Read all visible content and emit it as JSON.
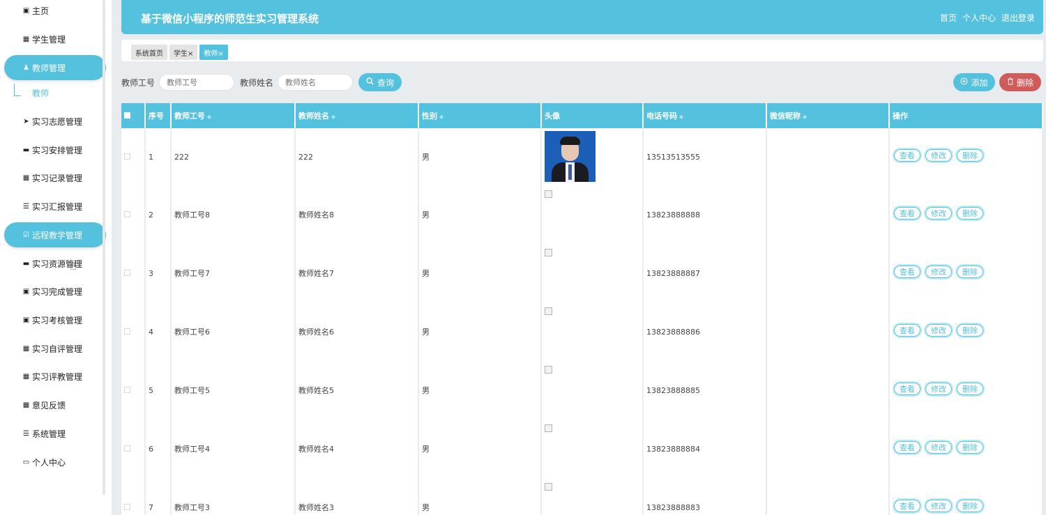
{
  "app_title": "基于微信小程序的师范生实习管理系统",
  "header_links": [
    "首页",
    "个人中心",
    "退出登录"
  ],
  "sidebar": {
    "items": [
      {
        "label": "主页",
        "icon": "home-icon",
        "glyph": "▣"
      },
      {
        "label": "学生管理",
        "icon": "grid-icon",
        "glyph": "▦"
      },
      {
        "label": "教师管理",
        "icon": "thumb-icon",
        "glyph": "♟"
      },
      {
        "label": "实习志愿管理",
        "icon": "send-icon",
        "glyph": "➤"
      },
      {
        "label": "实习安排管理",
        "icon": "monitor-icon",
        "glyph": "▬"
      },
      {
        "label": "实习记录管理",
        "icon": "grid-icon",
        "glyph": "▦"
      },
      {
        "label": "实习汇报管理",
        "icon": "list-icon",
        "glyph": "☰"
      },
      {
        "label": "远程教学管理",
        "icon": "check-square-icon",
        "glyph": "☑"
      },
      {
        "label": "实习资源管理",
        "icon": "monitor-icon",
        "glyph": "▬"
      },
      {
        "label": "实习完成管理",
        "icon": "clipboard-icon",
        "glyph": "▣"
      },
      {
        "label": "实习考核管理",
        "icon": "clipboard-icon",
        "glyph": "▣"
      },
      {
        "label": "实习自评管理",
        "icon": "grid-icon",
        "glyph": "▦"
      },
      {
        "label": "实习评教管理",
        "icon": "grid-icon",
        "glyph": "▦"
      },
      {
        "label": "意见反馈",
        "icon": "grid-icon",
        "glyph": "▦"
      },
      {
        "label": "系统管理",
        "icon": "list-icon",
        "glyph": "☰"
      },
      {
        "label": "个人中心",
        "icon": "card-icon",
        "glyph": "▭"
      }
    ],
    "submenu": "教师"
  },
  "tabs": [
    {
      "label": "系统首页",
      "active": false
    },
    {
      "label": "学生×",
      "active": false
    },
    {
      "label": "教师×",
      "active": true
    }
  ],
  "search": {
    "field1_label": "教师工号",
    "field1_placeholder": "教师工号",
    "field2_label": "教师姓名",
    "field2_placeholder": "教师姓名",
    "query_label": "查询",
    "query_icon": "search-icon"
  },
  "actions": {
    "add_label": "添加",
    "add_icon": "plus-circle-icon",
    "delete_label": "删除",
    "delete_icon": "trash-icon"
  },
  "table": {
    "columns": [
      "序号",
      "教师工号",
      "教师姓名",
      "性别",
      "头像",
      "电话号码",
      "微信昵称",
      "操作"
    ],
    "rows": [
      {
        "index": "1",
        "id": "222",
        "name": "222",
        "gender": "男",
        "phone": "13513513555",
        "wechat": "",
        "has_photo": true
      },
      {
        "index": "2",
        "id": "教师工号8",
        "name": "教师姓名8",
        "gender": "男",
        "phone": "13823888888",
        "wechat": "",
        "has_photo": false
      },
      {
        "index": "3",
        "id": "教师工号7",
        "name": "教师姓名7",
        "gender": "男",
        "phone": "13823888887",
        "wechat": "",
        "has_photo": false
      },
      {
        "index": "4",
        "id": "教师工号6",
        "name": "教师姓名6",
        "gender": "男",
        "phone": "13823888886",
        "wechat": "",
        "has_photo": false
      },
      {
        "index": "5",
        "id": "教师工号5",
        "name": "教师姓名5",
        "gender": "男",
        "phone": "13823888885",
        "wechat": "",
        "has_photo": false
      },
      {
        "index": "6",
        "id": "教师工号4",
        "name": "教师姓名4",
        "gender": "男",
        "phone": "13823888884",
        "wechat": "",
        "has_photo": false
      },
      {
        "index": "7",
        "id": "教师工号3",
        "name": "教师姓名3",
        "gender": "男",
        "phone": "13823888883",
        "wechat": "",
        "has_photo": false
      }
    ],
    "row_actions": [
      "查看",
      "修改",
      "删除"
    ]
  },
  "colors": {
    "accent": "#54c1de",
    "danger": "#d05b5b",
    "background": "#e9ecef"
  }
}
